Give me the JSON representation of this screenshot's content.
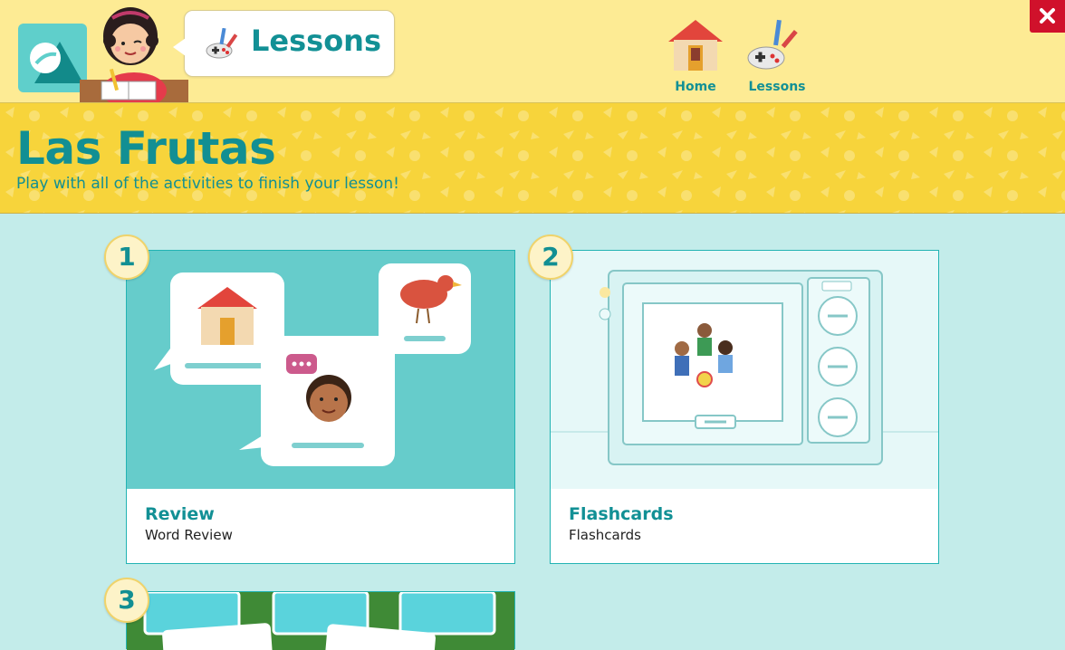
{
  "header": {
    "section_title": "Lessons",
    "nav": [
      {
        "label": "Home",
        "icon": "house-icon"
      },
      {
        "label": "Lessons",
        "icon": "gamepad-pencil-icon"
      }
    ],
    "close_icon": "close-icon"
  },
  "banner": {
    "title": "Las Frutas",
    "subtitle": "Play with all of the activities to finish your lesson!"
  },
  "activities": [
    {
      "number": "1",
      "title": "Review",
      "subtitle": "Word Review"
    },
    {
      "number": "2",
      "title": "Flashcards",
      "subtitle": "Flashcards"
    },
    {
      "number": "3",
      "title": "",
      "subtitle": ""
    }
  ],
  "colors": {
    "accent": "#129095",
    "topbar_bg": "#fdeb94",
    "banner_bg": "#f7d43b",
    "page_bg": "#c3ecea",
    "close_bg": "#d0112b"
  }
}
